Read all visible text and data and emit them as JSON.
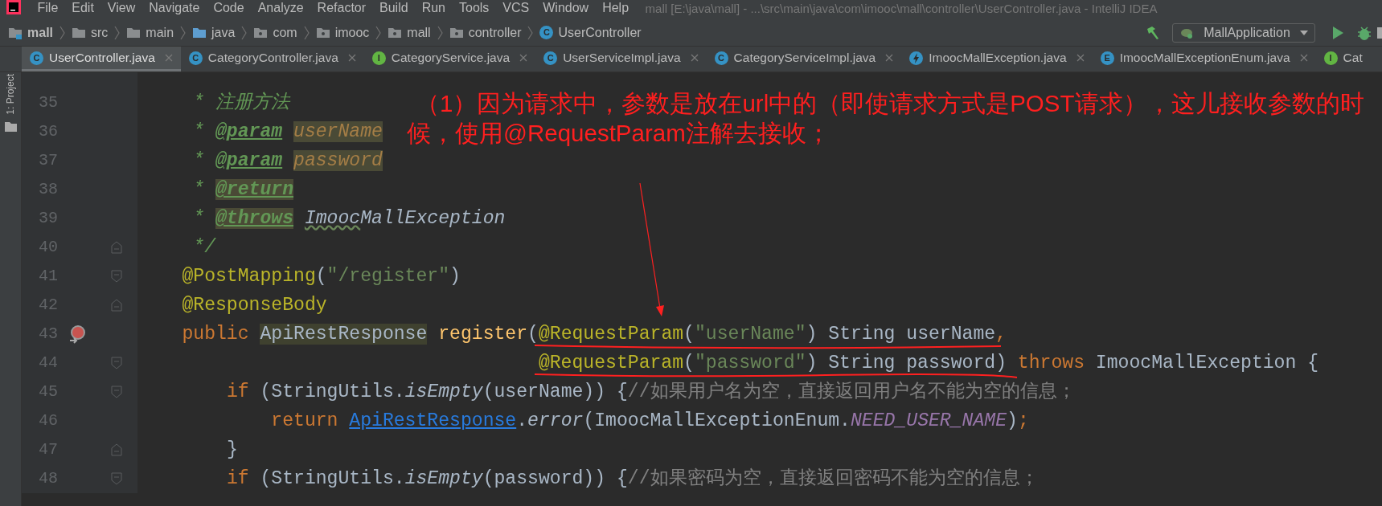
{
  "menu_bar": {
    "items": [
      "File",
      "Edit",
      "View",
      "Navigate",
      "Code",
      "Analyze",
      "Refactor",
      "Build",
      "Run",
      "Tools",
      "VCS",
      "Window",
      "Help"
    ],
    "title": "mall [E:\\java\\mall] - ...\\src\\main\\java\\com\\imooc\\mall\\controller\\UserController.java - IntelliJ IDEA"
  },
  "breadcrumbs": [
    {
      "label": "mall",
      "kind": "module"
    },
    {
      "label": "src",
      "kind": "folder"
    },
    {
      "label": "main",
      "kind": "folder"
    },
    {
      "label": "java",
      "kind": "source_folder"
    },
    {
      "label": "com",
      "kind": "package"
    },
    {
      "label": "imooc",
      "kind": "package"
    },
    {
      "label": "mall",
      "kind": "package"
    },
    {
      "label": "controller",
      "kind": "package"
    },
    {
      "label": "UserController",
      "kind": "class",
      "badge": "C"
    }
  ],
  "run_config": {
    "label": "MallApplication"
  },
  "tool_strip": {
    "label": "1: Project"
  },
  "tabs": [
    {
      "label": "UserController.java",
      "kind": "class",
      "badge": "C",
      "selected": true,
      "closable": true
    },
    {
      "label": "CategoryController.java",
      "kind": "class",
      "badge": "C",
      "selected": false,
      "closable": true
    },
    {
      "label": "CategoryService.java",
      "kind": "interface",
      "badge": "I",
      "selected": false,
      "closable": true
    },
    {
      "label": "UserServiceImpl.java",
      "kind": "class",
      "badge": "C",
      "selected": false,
      "closable": true
    },
    {
      "label": "CategoryServiceImpl.java",
      "kind": "class",
      "badge": "C",
      "selected": false,
      "closable": true
    },
    {
      "label": "ImoocMallException.java",
      "kind": "exception",
      "selected": false,
      "closable": true
    },
    {
      "label": "ImoocMallExceptionEnum.java",
      "kind": "enum",
      "badge": "E",
      "selected": false,
      "closable": true
    },
    {
      "label": "Cat",
      "kind": "interface",
      "badge": "I",
      "selected": false,
      "closable": false
    }
  ],
  "lines": [
    {
      "number": "35",
      "fold_open": false,
      "fold_close": false,
      "mapping_marker": false,
      "tokens": [
        {
          "kind": "doc",
          "text": "     * 注册方法"
        }
      ]
    },
    {
      "number": "36",
      "fold_open": false,
      "fold_close": false,
      "mapping_marker": false,
      "tokens": [
        {
          "kind": "doc",
          "text": "     * "
        },
        {
          "kind": "doc_tag",
          "text": "@param"
        },
        {
          "kind": "doc_param_hl",
          "text": " userName"
        }
      ]
    },
    {
      "number": "37",
      "fold_open": false,
      "fold_close": false,
      "mapping_marker": false,
      "tokens": [
        {
          "kind": "doc",
          "text": "     * "
        },
        {
          "kind": "doc_tag",
          "text": "@param"
        },
        {
          "kind": "doc_param_hl",
          "text": " password"
        }
      ]
    },
    {
      "number": "38",
      "fold_open": false,
      "fold_close": false,
      "mapping_marker": false,
      "tokens": [
        {
          "kind": "doc",
          "text": "     * "
        },
        {
          "kind": "doc_tag_hl",
          "text": "@return"
        }
      ]
    },
    {
      "number": "39",
      "fold_open": false,
      "fold_close": false,
      "mapping_marker": false,
      "tokens": [
        {
          "kind": "doc",
          "text": "     * "
        },
        {
          "kind": "doc_tag_hl",
          "text": "@throws"
        },
        {
          "kind": "doc_ref_typo",
          "text": " Imooc"
        },
        {
          "kind": "doc_ref",
          "text": "MallException"
        }
      ]
    },
    {
      "number": "40",
      "fold_open": false,
      "fold_close": true,
      "mapping_marker": false,
      "tokens": [
        {
          "kind": "doc",
          "text": "     */"
        }
      ]
    },
    {
      "number": "41",
      "fold_open": true,
      "fold_close": false,
      "mapping_marker": false,
      "tokens": [
        {
          "kind": "annotation",
          "text": "    @PostMapping"
        },
        {
          "kind": "plain",
          "text": "("
        },
        {
          "kind": "string",
          "text": "\"/register\""
        },
        {
          "kind": "plain",
          "text": ")"
        }
      ]
    },
    {
      "number": "42",
      "fold_open": false,
      "fold_close": true,
      "mapping_marker": false,
      "tokens": [
        {
          "kind": "annotation",
          "text": "    @ResponseBody"
        }
      ]
    },
    {
      "number": "43",
      "fold_open": false,
      "fold_close": false,
      "mapping_marker": true,
      "tokens": [
        {
          "kind": "keyword",
          "text": "    public "
        },
        {
          "kind": "type_hl",
          "text": "ApiRestResponse"
        },
        {
          "kind": "method_decl",
          "text": " register"
        },
        {
          "kind": "plain",
          "text": "("
        },
        {
          "kind": "annotation",
          "text": "@RequestParam"
        },
        {
          "kind": "plain",
          "text": "("
        },
        {
          "kind": "string",
          "text": "\"userName\""
        },
        {
          "kind": "plain",
          "text": ") String userName"
        },
        {
          "kind": "keyword",
          "text": ","
        }
      ]
    },
    {
      "number": "44",
      "fold_open": true,
      "fold_close": false,
      "mapping_marker": false,
      "tokens": [
        {
          "kind": "annotation",
          "text": "                                    @RequestParam"
        },
        {
          "kind": "plain",
          "text": "("
        },
        {
          "kind": "string",
          "text": "\"password\""
        },
        {
          "kind": "plain",
          "text": ") String password) "
        },
        {
          "kind": "keyword",
          "text": "throws"
        },
        {
          "kind": "plain",
          "text": " ImoocMallException {"
        }
      ]
    },
    {
      "number": "45",
      "fold_open": true,
      "fold_close": false,
      "mapping_marker": false,
      "tokens": [
        {
          "kind": "keyword",
          "text": "        if "
        },
        {
          "kind": "plain",
          "text": "(StringUtils."
        },
        {
          "kind": "static_call",
          "text": "isEmpty"
        },
        {
          "kind": "plain",
          "text": "(userName)) {"
        },
        {
          "kind": "comment",
          "text": "//如果用户名为空，直接返回用户名不能为空的信息；"
        }
      ]
    },
    {
      "number": "46",
      "fold_open": false,
      "fold_close": false,
      "mapping_marker": false,
      "tokens": [
        {
          "kind": "keyword",
          "text": "            return "
        },
        {
          "kind": "link",
          "text": "ApiRestResponse"
        },
        {
          "kind": "plain",
          "text": "."
        },
        {
          "kind": "static_call",
          "text": "error"
        },
        {
          "kind": "plain",
          "text": "(ImoocMallExceptionEnum."
        },
        {
          "kind": "constant",
          "text": "NEED_USER_NAME"
        },
        {
          "kind": "plain",
          "text": ")"
        },
        {
          "kind": "keyword",
          "text": ";"
        }
      ]
    },
    {
      "number": "47",
      "fold_open": false,
      "fold_close": true,
      "mapping_marker": false,
      "tokens": [
        {
          "kind": "plain",
          "text": "        }"
        }
      ]
    },
    {
      "number": "48",
      "fold_open": true,
      "fold_close": false,
      "mapping_marker": false,
      "tokens": [
        {
          "kind": "keyword",
          "text": "        if "
        },
        {
          "kind": "plain",
          "text": "(StringUtils."
        },
        {
          "kind": "static_call",
          "text": "isEmpty"
        },
        {
          "kind": "plain",
          "text": "(password)) {"
        },
        {
          "kind": "comment",
          "text": "//如果密码为空，直接返回密码不能为空的信息；"
        }
      ]
    }
  ],
  "note": {
    "lines": [
      "（1）因为请求中，参数是放在url中的（即使请求方式是POST请求），这儿接收参数的时",
      "候，使用@RequestParam注解去接收；"
    ]
  }
}
